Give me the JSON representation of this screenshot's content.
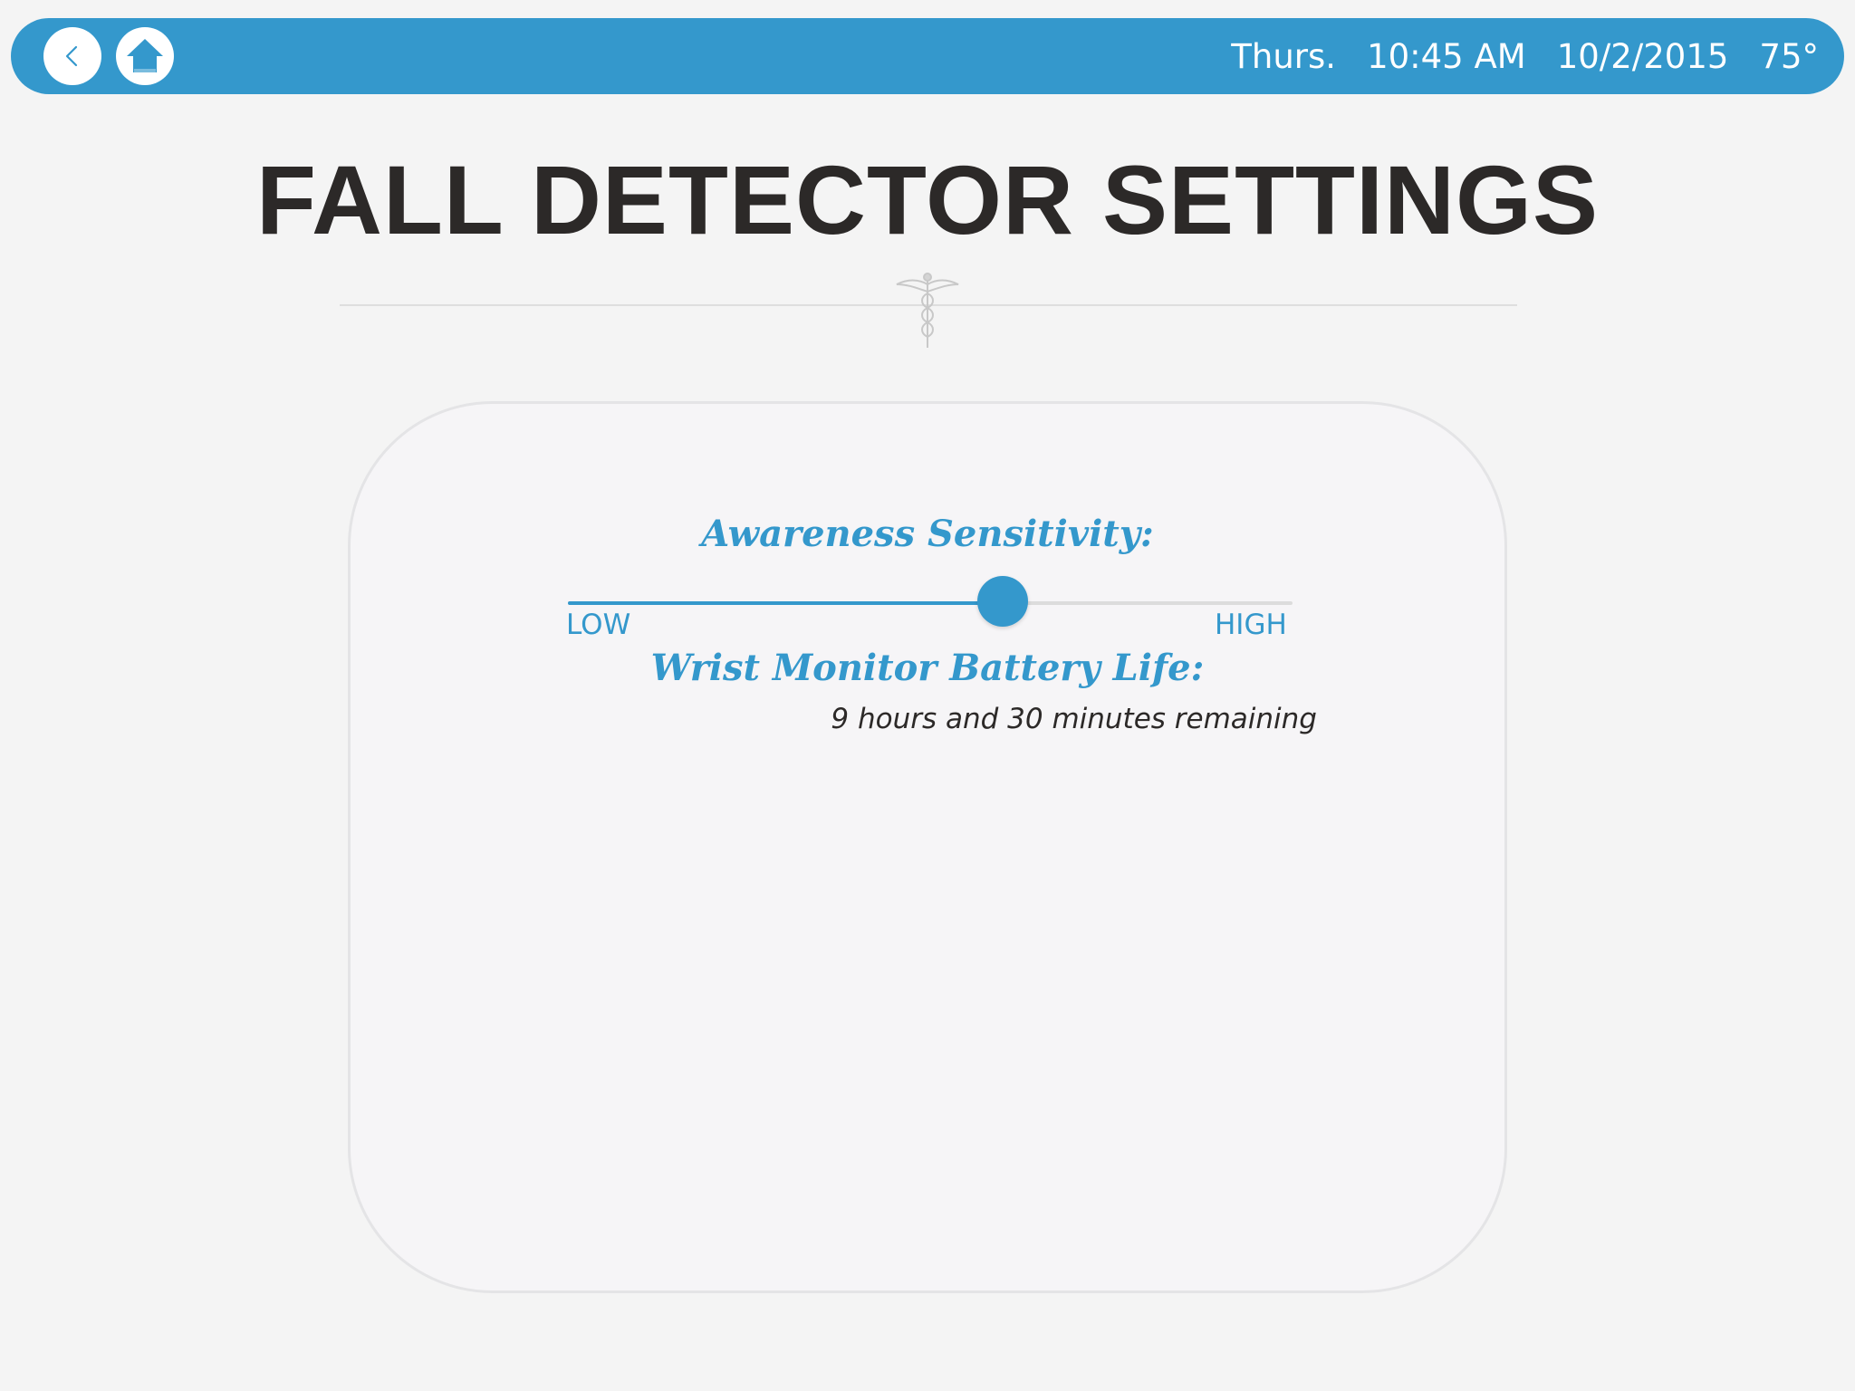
{
  "status_bar": {
    "day": "Thurs.",
    "time": "10:45 AM",
    "date": "10/2/2015",
    "temperature": "75°"
  },
  "icons": {
    "back": "chevron-left-icon",
    "home": "home-icon",
    "divider_emblem": "caduceus-icon"
  },
  "title": "FALL DETECTOR SETTINGS",
  "settings": {
    "sensitivity_heading": "Awareness Sensitivity:",
    "sensitivity_value_fraction": 0.6,
    "low_label": "LOW",
    "high_label": "HIGH",
    "battery_heading": "Wrist Monitor Battery Life:",
    "battery_remaining": "9 hours and 30 minutes remaining"
  },
  "colors": {
    "accent": "#3498cc",
    "title_text": "#2c2928",
    "background": "#f4f4f4"
  }
}
